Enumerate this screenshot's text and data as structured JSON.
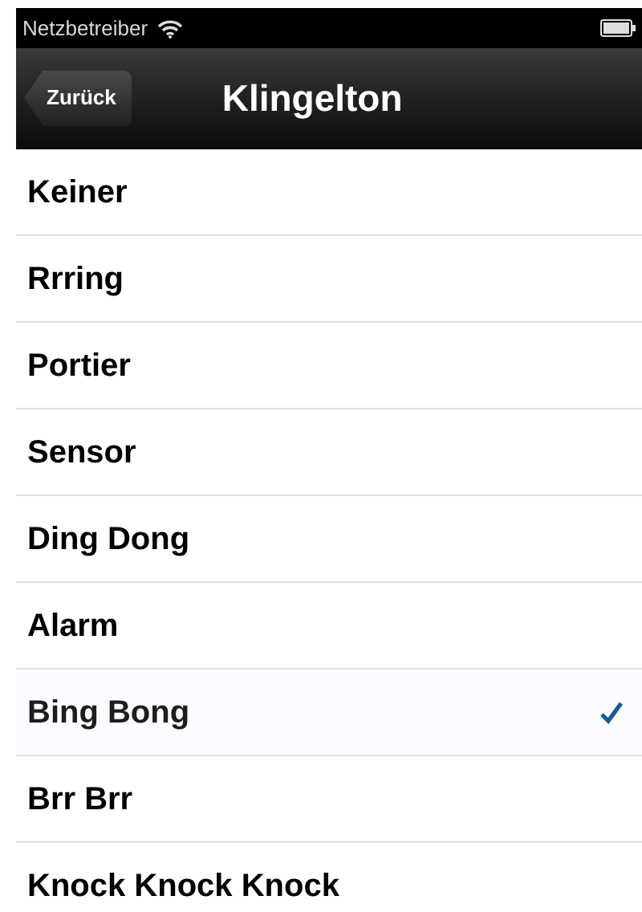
{
  "status_bar": {
    "carrier": "Netzbetreiber"
  },
  "nav_bar": {
    "back": "Zurück",
    "title": "Klingelton"
  },
  "ringtones": [
    {
      "label": "Keiner",
      "selected": false
    },
    {
      "label": "Rrring",
      "selected": false
    },
    {
      "label": "Portier",
      "selected": false
    },
    {
      "label": "Sensor",
      "selected": false
    },
    {
      "label": "Ding Dong",
      "selected": false
    },
    {
      "label": "Alarm",
      "selected": false
    },
    {
      "label": "Bing Bong",
      "selected": true
    },
    {
      "label": "Brr Brr",
      "selected": false
    },
    {
      "label": "Knock Knock Knock",
      "selected": false
    }
  ]
}
